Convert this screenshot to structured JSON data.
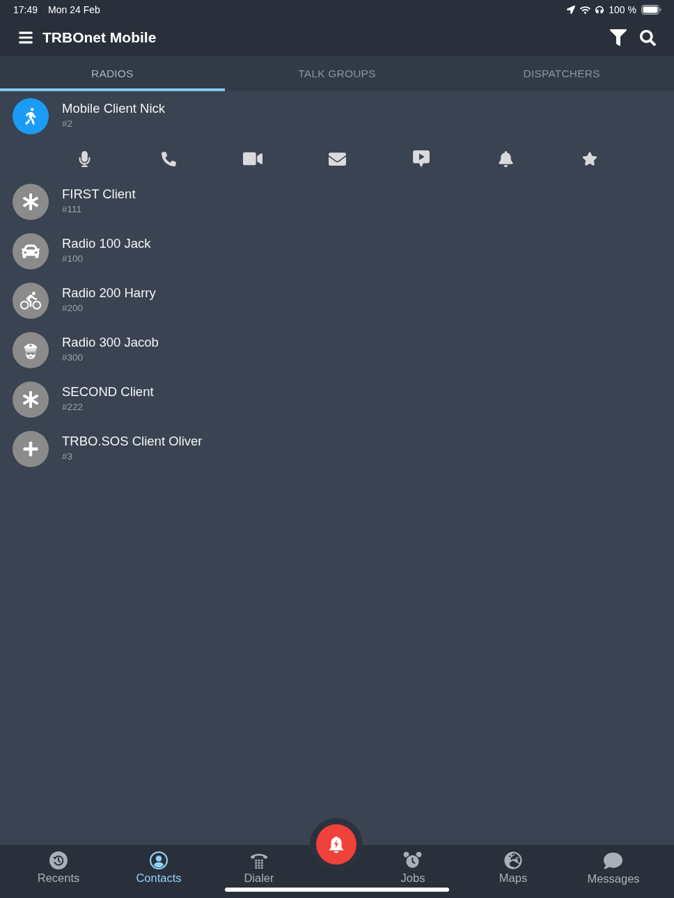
{
  "status_bar": {
    "time": "17:49",
    "date": "Mon 24 Feb",
    "battery": "100 %"
  },
  "app_bar": {
    "title": "TRBOnet Mobile"
  },
  "tabs": [
    {
      "label": "RADIOS",
      "selected": true
    },
    {
      "label": "TALK GROUPS",
      "selected": false
    },
    {
      "label": "DISPATCHERS",
      "selected": false
    }
  ],
  "contacts": [
    {
      "name": "Mobile Client Nick",
      "number": "#2",
      "kind": "walker",
      "selected": true
    },
    {
      "name": "FIRST Client",
      "number": "#111",
      "kind": "asterisk",
      "selected": false
    },
    {
      "name": "Radio 100 Jack",
      "number": "#100",
      "kind": "car",
      "selected": false
    },
    {
      "name": "Radio 200 Harry",
      "number": "#200",
      "kind": "bicycle",
      "selected": false
    },
    {
      "name": "Radio 300 Jacob",
      "number": "#300",
      "kind": "officer",
      "selected": false
    },
    {
      "name": "SECOND Client",
      "number": "#222",
      "kind": "asterisk",
      "selected": false
    },
    {
      "name": "TRBO.SOS Client Oliver",
      "number": "#3",
      "kind": "cross",
      "selected": false
    }
  ],
  "bottom_nav": [
    {
      "label": "Recents",
      "kind": "recents",
      "selected": false
    },
    {
      "label": "Contacts",
      "kind": "contacts",
      "selected": true
    },
    {
      "label": "Dialer",
      "kind": "dialer",
      "selected": false
    },
    {
      "label": "Jobs",
      "kind": "jobs",
      "selected": false
    },
    {
      "label": "Maps",
      "kind": "maps",
      "selected": false
    },
    {
      "label": "Messages",
      "kind": "messages",
      "selected": false
    }
  ]
}
